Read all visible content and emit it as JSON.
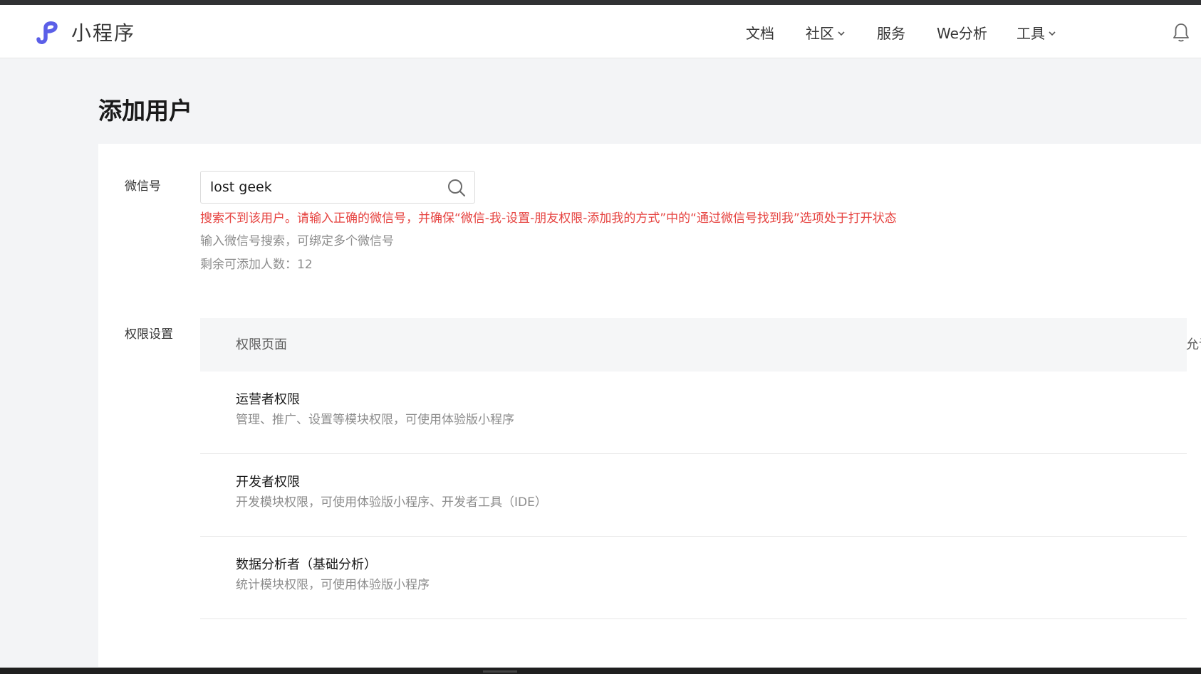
{
  "header": {
    "brand": "小程序",
    "brand_color": "#5b5fe8",
    "nav": [
      {
        "label": "文档",
        "has_dropdown": false
      },
      {
        "label": "社区",
        "has_dropdown": true
      },
      {
        "label": "服务",
        "has_dropdown": false
      },
      {
        "label": "We分析",
        "has_dropdown": false
      },
      {
        "label": "工具",
        "has_dropdown": true
      }
    ],
    "icons": [
      "miniprogram-logo-icon",
      "chevron-down-icon",
      "bell-icon"
    ]
  },
  "page": {
    "title": "添加用户"
  },
  "form": {
    "wechat_label": "微信号",
    "search_value": "lost geek",
    "error": "搜索不到该用户。请输入正确的微信号，并确保“微信-我-设置-朋友权限-添加我的方式”中的“通过微信号找到我”选项处于打开状态",
    "error_color": "#e64340",
    "hint": "输入微信号搜索，可绑定多个微信号",
    "remaining": "剩余可添加人数：12",
    "permissions_label": "权限设置"
  },
  "permissions_table": {
    "headers": [
      "权限页面",
      "允许访问"
    ],
    "rows": [
      {
        "title": "运营者权限",
        "desc": "管理、推广、设置等模块权限，可使用体验版小程序",
        "checked": false
      },
      {
        "title": "开发者权限",
        "desc": "开发模块权限，可使用体验版小程序、开发者工具（IDE）",
        "checked": false
      },
      {
        "title": "数据分析者（基础分析）",
        "desc": "统计模块权限，可使用体验版小程序",
        "checked": false
      }
    ]
  }
}
